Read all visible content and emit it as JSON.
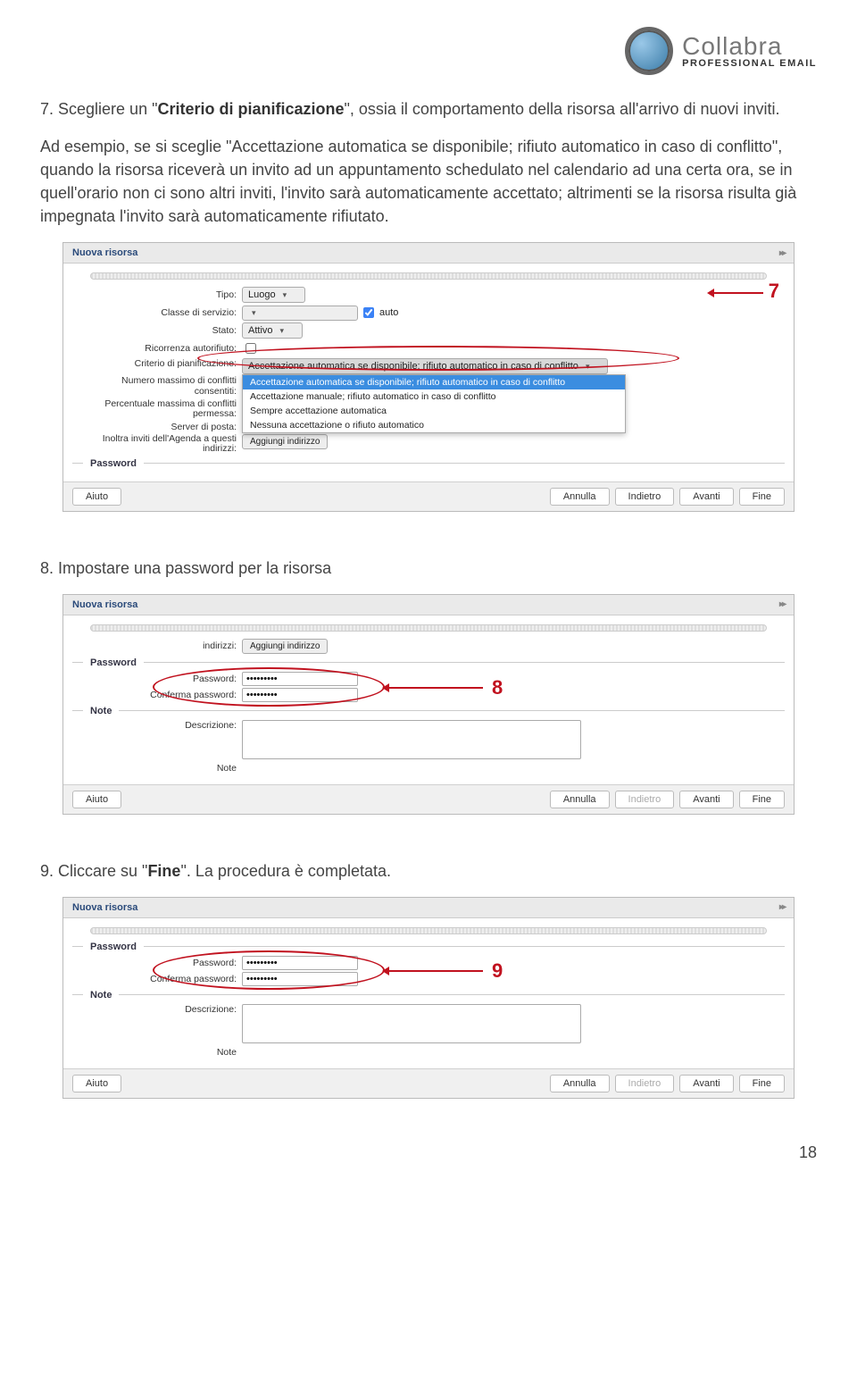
{
  "logo": {
    "brand": "Collabra",
    "subtitle": "PROFESSIONAL EMAIL"
  },
  "section7": {
    "num": "7. ",
    "lead1": "Scegliere un \"",
    "criterio": "Criterio di pianificazione",
    "lead2": "\", ossia il comportamento della risorsa all'arrivo di nuovi inviti.",
    "body": "Ad esempio, se si sceglie \"Accettazione automatica se disponibile; rifiuto automatico in caso di conflitto\", quando la risorsa riceverà un invito ad un appuntamento schedulato nel calendario ad una certa ora, se in quell'orario non ci sono altri inviti, l'invito sarà automaticamente accettato; altrimenti se la risorsa risulta già impegnata l'invito sarà automaticamente rifiutato."
  },
  "section8": {
    "text": "8. Impostare una password per la risorsa"
  },
  "section9": {
    "t1": "9. Cliccare su \"",
    "bold": "Fine",
    "t2": "\". La procedura è completata."
  },
  "dialog": {
    "title": "Nuova risorsa",
    "labels": {
      "tipo": "Tipo:",
      "classe": "Classe di servizio:",
      "stato": "Stato:",
      "ricorrenza": "Ricorrenza autorifiuto:",
      "criterio": "Criterio di pianificazione:",
      "numMax1": "Numero massimo di conflitti",
      "numMax2": "consentiti:",
      "perc1": "Percentuale massima di conflitti",
      "perc2": "permessa:",
      "server": "Server di posta:",
      "inoltra1": "Inoltra inviti dell'Agenda a questi",
      "inoltra2": "indirizzi:",
      "password": "Password:",
      "conferma": "Conferma password:",
      "descrizione": "Descrizione:",
      "note": "Note"
    },
    "values": {
      "tipo": "Luogo",
      "stato": "Attivo",
      "autoCheck": "auto",
      "criterioSel": "Accettazione automatica se disponibile; rifiuto automatico in caso di conflitto",
      "aggiungi": "Aggiungi indirizzo",
      "passwordGroup": "Password",
      "noteGroup": "Note",
      "dots": "•••••••••"
    },
    "dropdownOptions": [
      "Accettazione automatica se disponibile; rifiuto automatico in caso di conflitto",
      "Accettazione manuale; rifiuto automatico in caso di conflitto",
      "Sempre accettazione automatica",
      "Nessuna accettazione o rifiuto automatico"
    ],
    "footer": {
      "aiuto": "Aiuto",
      "annulla": "Annulla",
      "indietro": "Indietro",
      "avanti": "Avanti",
      "fine": "Fine"
    }
  },
  "callouts": {
    "c7": "7",
    "c8": "8",
    "c9": "9"
  },
  "pageNumber": "18"
}
